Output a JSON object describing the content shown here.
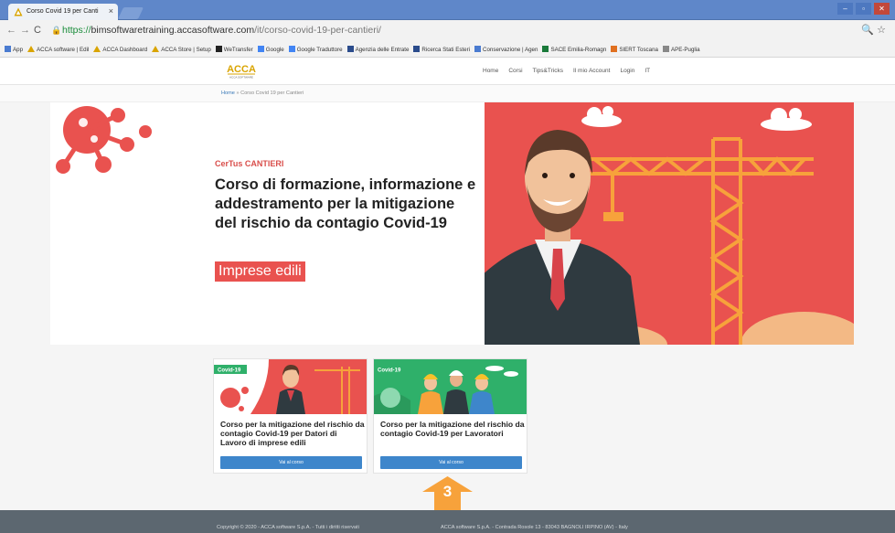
{
  "browser": {
    "tab_title": "Corso Covid 19 per Canti",
    "tab_close": "×",
    "url_scheme": "https://",
    "url_host": "bimsoftwaretraining.accasoftware.com",
    "url_path": "/it/corso-covid-19-per-cantieri/",
    "bookmarks": [
      {
        "label": "App",
        "icon": "apps-grid-icon",
        "color": "#4a7bd0"
      },
      {
        "label": "ACCA software | Edil",
        "icon": "acca-triangle-icon",
        "color": "#d9a400"
      },
      {
        "label": "ACCA Dashboard",
        "icon": "acca-triangle-icon",
        "color": "#d9a400"
      },
      {
        "label": "ACCA Store | Setup",
        "icon": "acca-triangle-icon",
        "color": "#d9a400"
      },
      {
        "label": "WeTransfer",
        "icon": "wetransfer-icon",
        "color": "#222222"
      },
      {
        "label": "Google",
        "icon": "google-icon",
        "color": "#4285f4"
      },
      {
        "label": "Google Traduttore",
        "icon": "translate-icon",
        "color": "#4285f4"
      },
      {
        "label": "Agenzia delle Entrate",
        "icon": "agency-icon",
        "color": "#2b4c8c"
      },
      {
        "label": "Ricerca Stati Esteri",
        "icon": "agency-icon",
        "color": "#2b4c8c"
      },
      {
        "label": "Conservazione | Agen",
        "icon": "page-icon",
        "color": "#4a7bd0"
      },
      {
        "label": "SACE Emilia-Romagn",
        "icon": "sace-icon",
        "color": "#1a7a3a"
      },
      {
        "label": "SIERT Toscana",
        "icon": "siert-icon",
        "color": "#e07020"
      },
      {
        "label": "APE-Puglia",
        "icon": "page-icon",
        "color": "#888888"
      }
    ]
  },
  "site": {
    "logo_text": "ACCA",
    "logo_sub": "ACCA SOFTWARE",
    "nav": [
      "Home",
      "Corsi",
      "Tips&Tricks",
      "Il mio Account",
      "Login",
      "IT"
    ],
    "breadcrumb_home": "Home",
    "breadcrumb_sep": " » ",
    "breadcrumb_current": "Corso Covid 19 per Cantieri"
  },
  "hero": {
    "subtitle": "CerTus CANTIERI",
    "title": "Corso di formazione, informazione e addestramento per la mitigazione del rischio da contagio Covid-19",
    "badge": "Imprese edili"
  },
  "cards": [
    {
      "tag": "Covid-19",
      "title": "Corso per la mitigazione del rischio da contagio Covid-19 per Datori di Lavoro di imprese edili",
      "button": "Vai al corso",
      "bg": "#e9524f"
    },
    {
      "tag": "Covid-19",
      "title": "Corso per la mitigazione del rischio da contagio Covid-19 per Lavoratori",
      "button": "Vai al corso",
      "bg": "#2fb06a"
    }
  ],
  "step_marker": "3",
  "footer": {
    "left": "Copyright © 2020 - ACCA software S.p.A. - Tutti i diritti riservati",
    "right": "ACCA software S.p.A. - Contrada Rosole 13 - 83043 BAGNOLI IRPINO (AV) - Italy"
  },
  "colors": {
    "accent_red": "#e9524f",
    "accent_blue": "#3e86cb",
    "step_orange": "#f7a23b",
    "footer": "#5c6770"
  }
}
